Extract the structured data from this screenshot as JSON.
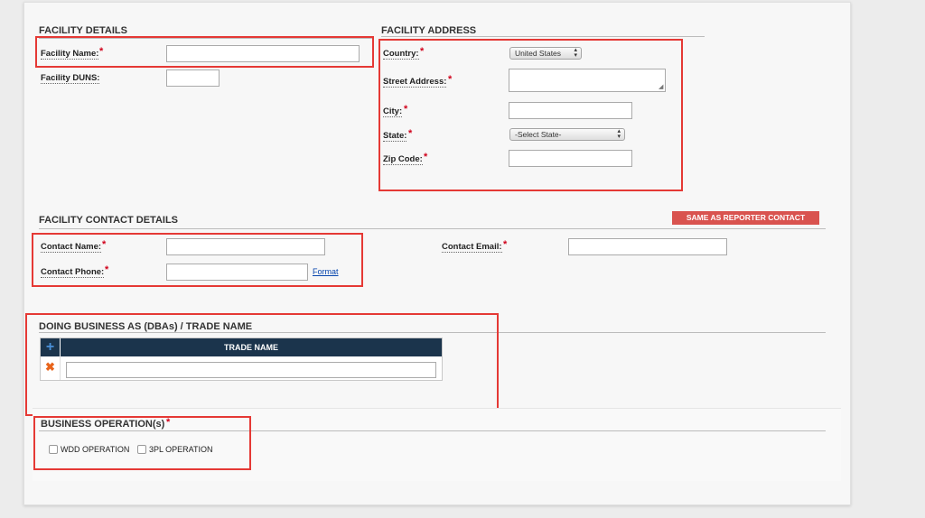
{
  "facility_details": {
    "title": "FACILITY DETAILS",
    "name_label": "Facility Name:",
    "duns_label": "Facility DUNS:"
  },
  "facility_address": {
    "title": "FACILITY ADDRESS",
    "country_label": "Country:",
    "country_value": "United States",
    "street_label": "Street Address:",
    "city_label": "City:",
    "state_label": "State:",
    "state_value": "-Select State-",
    "zip_label": "Zip Code:"
  },
  "contact": {
    "title": "FACILITY CONTACT DETAILS",
    "same_as_button": "SAME AS REPORTER CONTACT",
    "name_label": "Contact Name:",
    "phone_label": "Contact Phone:",
    "format_link": "Format",
    "email_label": "Contact Email:"
  },
  "dba": {
    "title": "DOING BUSINESS AS (DBAs) / TRADE NAME",
    "column_header": "TRADE NAME",
    "add_icon": "plus-icon",
    "remove_icon": "remove-x-icon"
  },
  "operations": {
    "title": "BUSINESS OPERATION(s)",
    "options": [
      "WDD OPERATION",
      "3PL OPERATION"
    ]
  },
  "required_mark": "*",
  "colors": {
    "required": "#d0021b",
    "highlight": "#e53935",
    "header_dark": "#1b344c",
    "button_red": "#d9534f",
    "add_icon": "#4a90d9",
    "remove_icon": "#e8641b"
  }
}
